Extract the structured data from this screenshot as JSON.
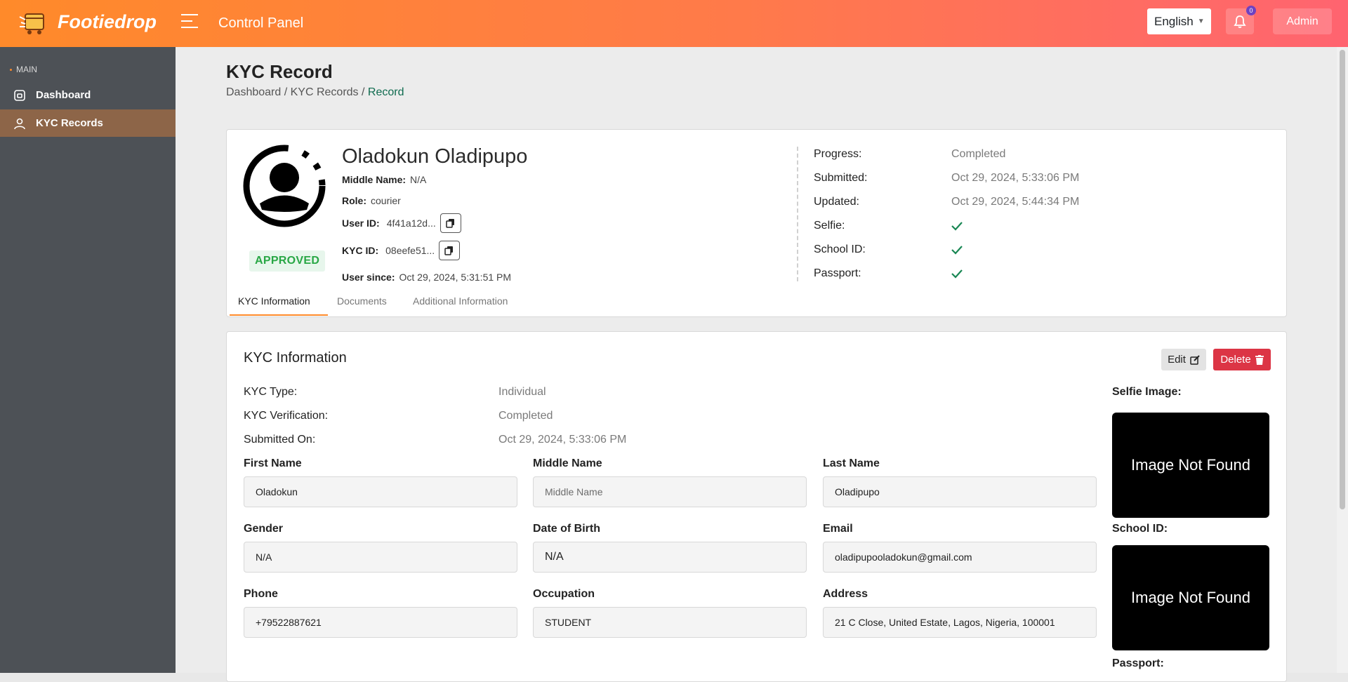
{
  "header": {
    "brand": "Footiedrop",
    "panel_title": "Control Panel",
    "language": "English",
    "notification_count": "0",
    "admin_label": "Admin"
  },
  "sidebar": {
    "section": "MAIN",
    "items": [
      {
        "label": "Dashboard",
        "icon": "dashboard-icon"
      },
      {
        "label": "KYC Records",
        "icon": "user-icon",
        "active": true
      }
    ]
  },
  "page": {
    "title": "KYC Record",
    "breadcrumb": [
      "Dashboard",
      "KYC Records",
      "Record"
    ]
  },
  "profile": {
    "name": "Oladokun Oladipupo",
    "status": "APPROVED",
    "middle_name_label": "Middle Name:",
    "middle_name": "N/A",
    "role_label": "Role:",
    "role": "courier",
    "user_id_label": "User ID:",
    "user_id": "4f41a12d...",
    "kyc_id_label": "KYC ID:",
    "kyc_id": "08eefe51...",
    "user_since_label": "User since:",
    "user_since": "Oct 29, 2024, 5:31:51 PM"
  },
  "status": {
    "progress_label": "Progress:",
    "progress": "Completed",
    "submitted_label": "Submitted:",
    "submitted": "Oct 29, 2024, 5:33:06 PM",
    "updated_label": "Updated:",
    "updated": "Oct 29, 2024, 5:44:34 PM",
    "selfie_label": "Selfie:",
    "school_id_label": "School ID:",
    "passport_label": "Passport:",
    "check_color": "#198754"
  },
  "tabs": [
    "KYC Information",
    "Documents",
    "Additional Information"
  ],
  "kyc": {
    "section_title": "KYC Information",
    "edit_label": "Edit",
    "delete_label": "Delete",
    "type_label": "KYC Type:",
    "type": "Individual",
    "verification_label": "KYC Verification:",
    "verification": "Completed",
    "submitted_on_label": "Submitted On:",
    "submitted_on": "Oct 29, 2024, 5:33:06 PM",
    "fields": {
      "first_name_label": "First Name",
      "first_name": "Oladokun",
      "middle_name_label": "Middle Name",
      "middle_name_placeholder": "Middle Name",
      "last_name_label": "Last Name",
      "last_name": "Oladipupo",
      "gender_label": "Gender",
      "gender": "N/A",
      "dob_label": "Date of Birth",
      "dob": "N/A",
      "email_label": "Email",
      "email": "oladipupooladokun@gmail.com",
      "phone_label": "Phone",
      "phone": "+79522887621",
      "occupation_label": "Occupation",
      "occupation": "STUDENT",
      "address_label": "Address",
      "address": "21 C Close, United Estate, Lagos, Nigeria, 100001"
    },
    "selfie_label": "Selfie Image:",
    "school_id_label": "School ID:",
    "passport_label": "Passport:",
    "image_missing": "Image Not Found"
  },
  "colors": {
    "accent": "#ff8a2a",
    "sidebar": "#4d5156",
    "approved": "#28a745",
    "danger": "#dc3545"
  }
}
